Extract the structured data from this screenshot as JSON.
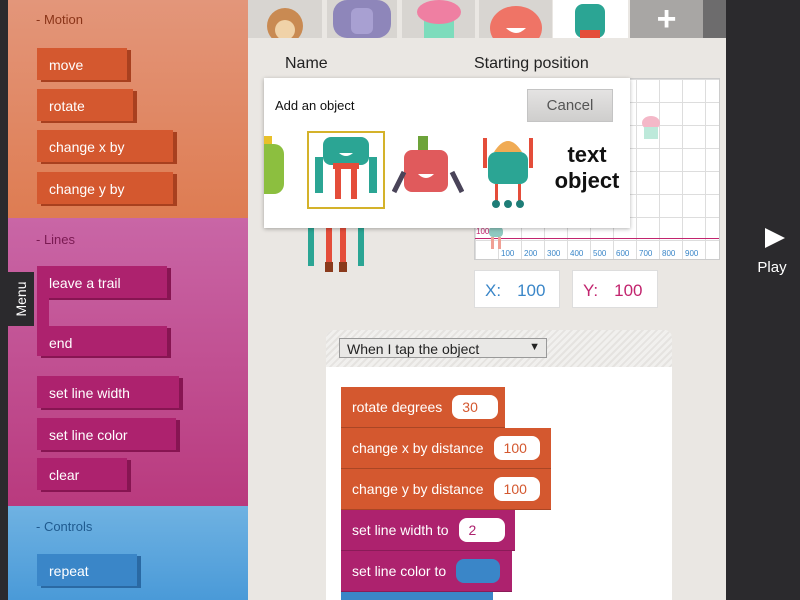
{
  "sidebar": {
    "menu_label": "Menu",
    "motion": {
      "title": "- Motion",
      "items": [
        "move",
        "rotate",
        "change x by",
        "change y by"
      ]
    },
    "lines": {
      "title": "- Lines",
      "items": [
        "leave a trail",
        "end",
        "set line width",
        "set line color",
        "clear"
      ]
    },
    "controls": {
      "title": "- Controls",
      "items": [
        "repeat"
      ]
    }
  },
  "tabs": {
    "characters": [
      "monkey",
      "gorilla",
      "cupcake",
      "octopus",
      "teal-monster"
    ],
    "selected": 4,
    "add_icon": "plus-icon"
  },
  "main": {
    "name_label": "Name",
    "position_label": "Starting position",
    "grid": {
      "x_ticks": [
        "100",
        "200",
        "300",
        "400",
        "500",
        "600",
        "700",
        "800",
        "900"
      ],
      "y_tick": "100"
    },
    "x": {
      "label": "X:",
      "value": "100"
    },
    "y": {
      "label": "Y:",
      "value": "100"
    }
  },
  "popup": {
    "title": "Add an object",
    "cancel": "Cancel",
    "text_object_line1": "text",
    "text_object_line2": "object",
    "objects": [
      "green-monster",
      "teal-monster",
      "red-monster",
      "robot",
      "text object"
    ],
    "selected": 1
  },
  "script": {
    "trigger": "When I tap the object",
    "blocks": [
      {
        "label": "rotate degrees",
        "value": "30"
      },
      {
        "label": "change x by distance",
        "value": "100"
      },
      {
        "label": "change y by distance",
        "value": "100"
      },
      {
        "label": "set line width to",
        "value": "2"
      },
      {
        "label": "set line color to",
        "color": "#3a86c8"
      }
    ]
  },
  "play": {
    "label": "Play"
  },
  "colors": {
    "motion": "#d4582f",
    "lines": "#ad226e",
    "controls": "#3a86c8"
  }
}
